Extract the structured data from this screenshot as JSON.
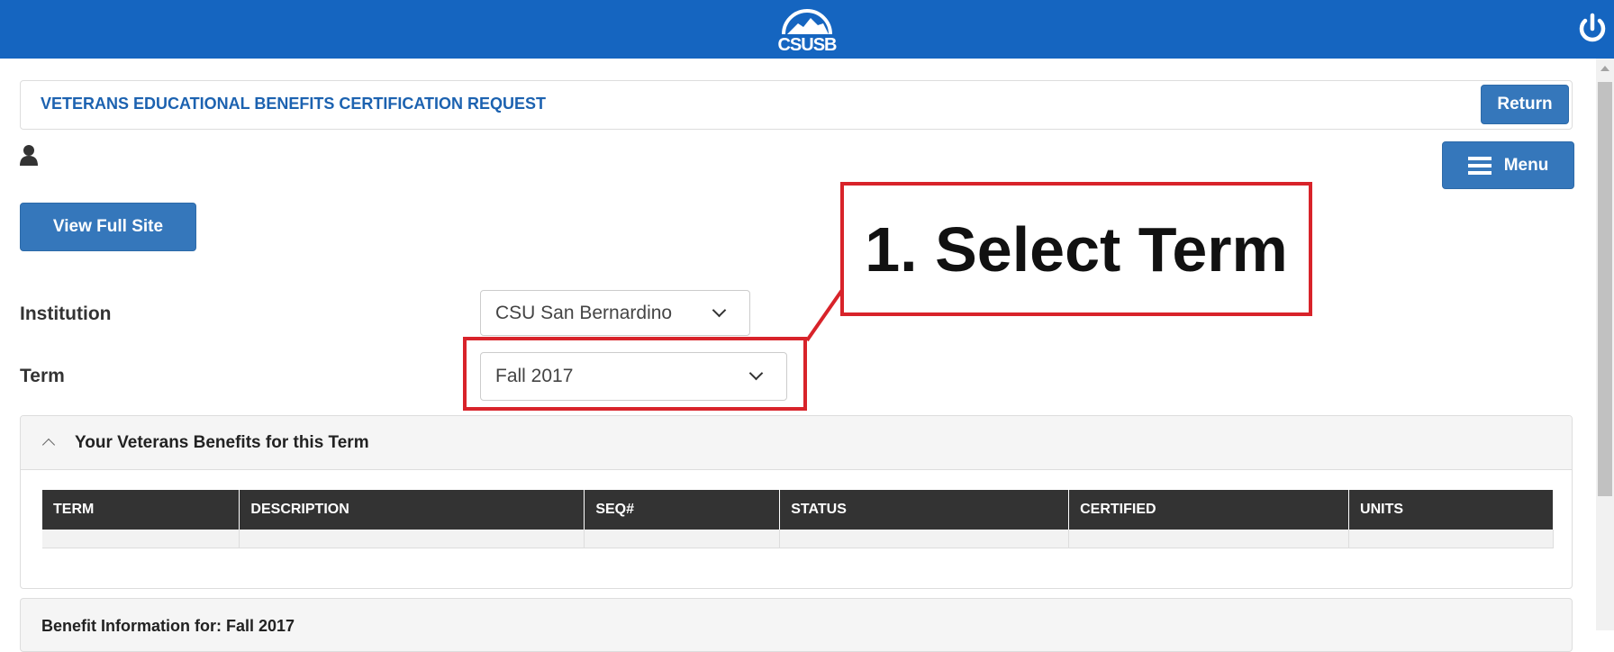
{
  "header": {
    "logo_text": "CSUSB",
    "brand_color": "#1565c0",
    "power_icon": "power-icon"
  },
  "page": {
    "title": "VETERANS EDUCATIONAL BENEFITS CERTIFICATION REQUEST",
    "return_label": "Return",
    "menu_label": "Menu",
    "view_full_site_label": "View Full Site"
  },
  "form": {
    "institution_label": "Institution",
    "institution_value": "CSU San Bernardino",
    "term_label": "Term",
    "term_value": "Fall 2017"
  },
  "annotation": {
    "text": "1. Select Term",
    "color": "#d8232a"
  },
  "benefits_panel": {
    "title": "Your Veterans Benefits for this Term",
    "columns": [
      "TERM",
      "DESCRIPTION",
      "SEQ#",
      "STATUS",
      "CERTIFIED",
      "UNITS"
    ]
  },
  "benefit_info": {
    "title": "Benefit Information for: Fall 2017"
  }
}
